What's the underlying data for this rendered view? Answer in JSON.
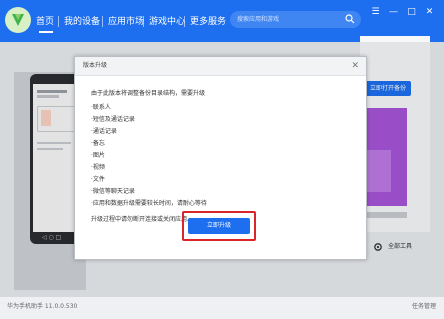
{
  "app": {
    "nav": [
      {
        "label": "首页"
      },
      {
        "label": "我的设备"
      },
      {
        "label": "应用市场"
      },
      {
        "label": "游戏中心"
      },
      {
        "label": "更多服务"
      }
    ],
    "search": {
      "placeholder": "搜索应用和游戏"
    },
    "window_buttons": [
      "☰",
      "—",
      "□",
      "✕"
    ]
  },
  "right_panel": {
    "button_label": "立即打开备份"
  },
  "bottom_tool": {
    "label": "全部工具"
  },
  "status": {
    "left": "华为手机助手 11.0.0.530",
    "right": "任务管理"
  },
  "dialog": {
    "title": "版本升级",
    "lines": [
      "由于此版本将调整备份目录结构，需要升级",
      "·联系人",
      "·短信及通话记录",
      "·通话记录",
      "·备忘",
      "·图片",
      "·视频",
      "·文件",
      "·微信等聊天记录",
      "·应用和数据升级需要较长时间，请耐心等待",
      "升级过程中请勿断开连接或关闭应用。"
    ],
    "restore_label": "立即升级"
  },
  "colors": {
    "brand": "#1d6ff0",
    "highlight": "#d9262a",
    "accent": "#a655d8"
  }
}
